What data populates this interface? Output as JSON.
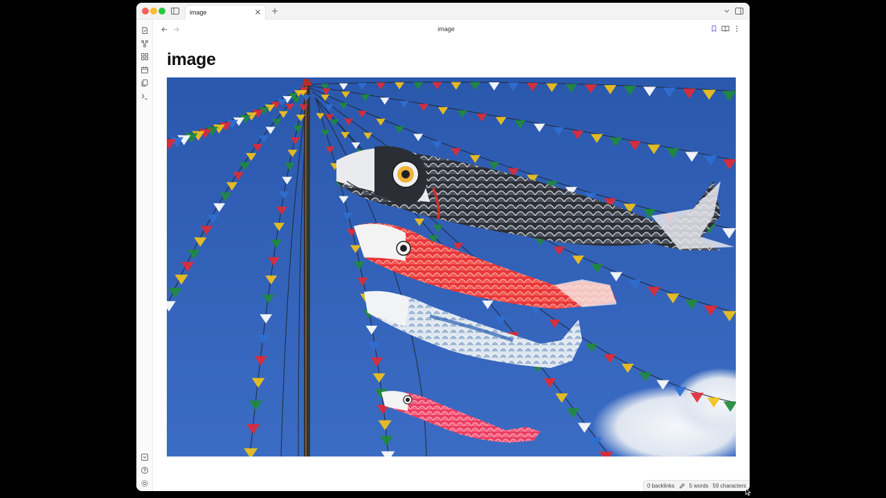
{
  "tab": {
    "title": "image"
  },
  "header": {
    "title": "image"
  },
  "note": {
    "title": "image",
    "image_alt": "Koinobori carp streamers and colourful pennant flags against a blue sky"
  },
  "status": {
    "backlinks": "0 backlinks",
    "words": "5 words",
    "characters": "59 characters"
  },
  "colors": {
    "accent": "#7b6cd9",
    "sky": "#2e5fb5"
  },
  "icons": {
    "ribbon": [
      "file-icon",
      "graph-icon",
      "canvas-icon",
      "calendar-icon",
      "copy-icon",
      "terminal-icon"
    ],
    "ribbon_bottom": [
      "vault-icon",
      "help-icon",
      "settings-icon"
    ]
  }
}
